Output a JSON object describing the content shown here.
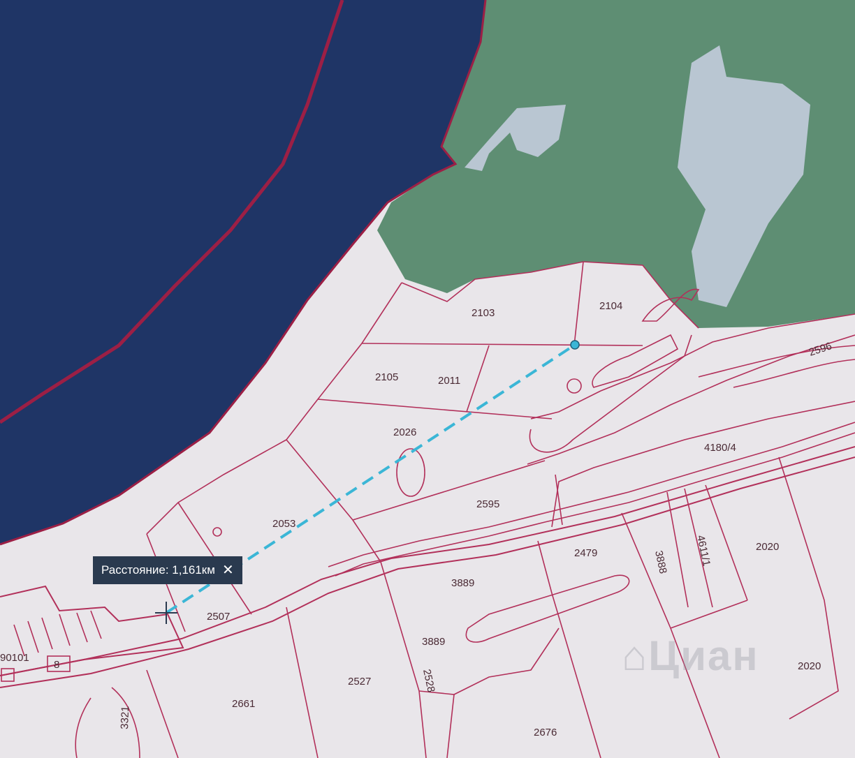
{
  "map": {
    "colors": {
      "water": "#1f3566",
      "forest": "#5e8e73",
      "land": "#e9e6ea",
      "boundary": "#b2305a",
      "measure_line": "#3bb6d6"
    },
    "parcels": [
      {
        "id": "p2103",
        "label": "2103"
      },
      {
        "id": "p2104",
        "label": "2104"
      },
      {
        "id": "p2105",
        "label": "2105"
      },
      {
        "id": "p2011",
        "label": "2011"
      },
      {
        "id": "p2026",
        "label": "2026"
      },
      {
        "id": "p2596",
        "label": "2596"
      },
      {
        "id": "p4180",
        "label": "4180/4"
      },
      {
        "id": "p2595",
        "label": "2595"
      },
      {
        "id": "p2053",
        "label": "2053"
      },
      {
        "id": "p2479",
        "label": "2479"
      },
      {
        "id": "p3888",
        "label": "3888"
      },
      {
        "id": "p4611",
        "label": "4611/1"
      },
      {
        "id": "p2020a",
        "label": "2020"
      },
      {
        "id": "p3889a",
        "label": "3889"
      },
      {
        "id": "p2507",
        "label": "2507"
      },
      {
        "id": "p3889b",
        "label": "3889"
      },
      {
        "id": "p2527",
        "label": "2527"
      },
      {
        "id": "p2528",
        "label": "2528"
      },
      {
        "id": "p2661",
        "label": "2661"
      },
      {
        "id": "p2676",
        "label": "2676"
      },
      {
        "id": "p2020b",
        "label": "2020"
      },
      {
        "id": "p8",
        "label": "8"
      },
      {
        "id": "p90101",
        "label": "90101"
      },
      {
        "id": "p3321",
        "label": "3321"
      }
    ]
  },
  "measure": {
    "label": "Расстояние: 1,161км",
    "close_icon": "close-icon"
  },
  "watermark": {
    "brand": "Циан",
    "icon": "cian-logo-icon"
  }
}
